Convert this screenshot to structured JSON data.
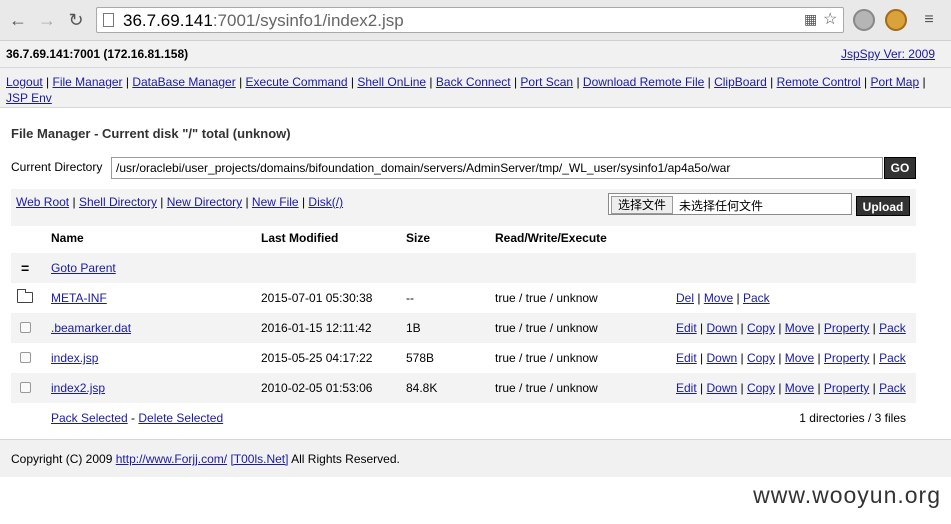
{
  "browser": {
    "url_host": "36.7.69.141",
    "url_rest": ":7001/sysinfo1/index2.jsp"
  },
  "header": {
    "host": "36.7.69.141:7001 (172.16.81.158)",
    "version": "JspSpy Ver: 2009"
  },
  "menu": [
    "Logout",
    "File Manager",
    "DataBase Manager",
    "Execute Command",
    "Shell OnLine",
    "Back Connect",
    "Port Scan",
    "Download Remote File",
    "ClipBoard",
    "Remote Control",
    "Port Map",
    "JSP Env"
  ],
  "file_manager": {
    "title": "File Manager - Current disk \"/\" total (unknow)",
    "current_dir_label": "Current Directory",
    "current_dir_value": "/usr/oraclebi/user_projects/domains/bifoundation_domain/servers/AdminServer/tmp/_WL_user/sysinfo1/ap4a5o/war",
    "go_label": "GO",
    "toolbar_links": [
      "Web Root",
      "Shell Directory",
      "New Directory",
      "New File",
      "Disk(/)"
    ],
    "choose_file_label": "选择文件",
    "no_file_label": "未选择任何文件",
    "upload_label": "Upload",
    "columns": [
      "Name",
      "Last Modified",
      "Size",
      "Read/Write/Execute"
    ],
    "parent_symbol": "=",
    "goto_parent": "Goto Parent",
    "rows": [
      {
        "name": "META-INF",
        "modified": "2015-07-01 05:30:38",
        "size": "--",
        "rwx": "true / true / unknow",
        "actions": [
          "Del",
          "Move",
          "Pack"
        ],
        "type": "dir"
      },
      {
        "name": ".beamarker.dat",
        "modified": "2016-01-15 12:11:42",
        "size": "1B",
        "rwx": "true / true / unknow",
        "actions": [
          "Edit",
          "Down",
          "Copy",
          "Move",
          "Property",
          "Pack"
        ],
        "type": "file"
      },
      {
        "name": "index.jsp",
        "modified": "2015-05-25 04:17:22",
        "size": "578B",
        "rwx": "true / true / unknow",
        "actions": [
          "Edit",
          "Down",
          "Copy",
          "Move",
          "Property",
          "Pack"
        ],
        "type": "file"
      },
      {
        "name": "index2.jsp",
        "modified": "2010-02-05 01:53:06",
        "size": "84.8K",
        "rwx": "true / true / unknow",
        "actions": [
          "Edit",
          "Down",
          "Copy",
          "Move",
          "Property",
          "Pack"
        ],
        "type": "file"
      }
    ],
    "pack_selected": "Pack Selected",
    "delete_selected": "Delete Selected",
    "summary": "1 directories / 3 files"
  },
  "footer": {
    "copyright": "Copyright (C) 2009",
    "link1": "http://www.Forjj.com/",
    "link2": "[T00ls.Net]",
    "rights": "All Rights Reserved."
  },
  "watermark": "www.wooyun.org"
}
